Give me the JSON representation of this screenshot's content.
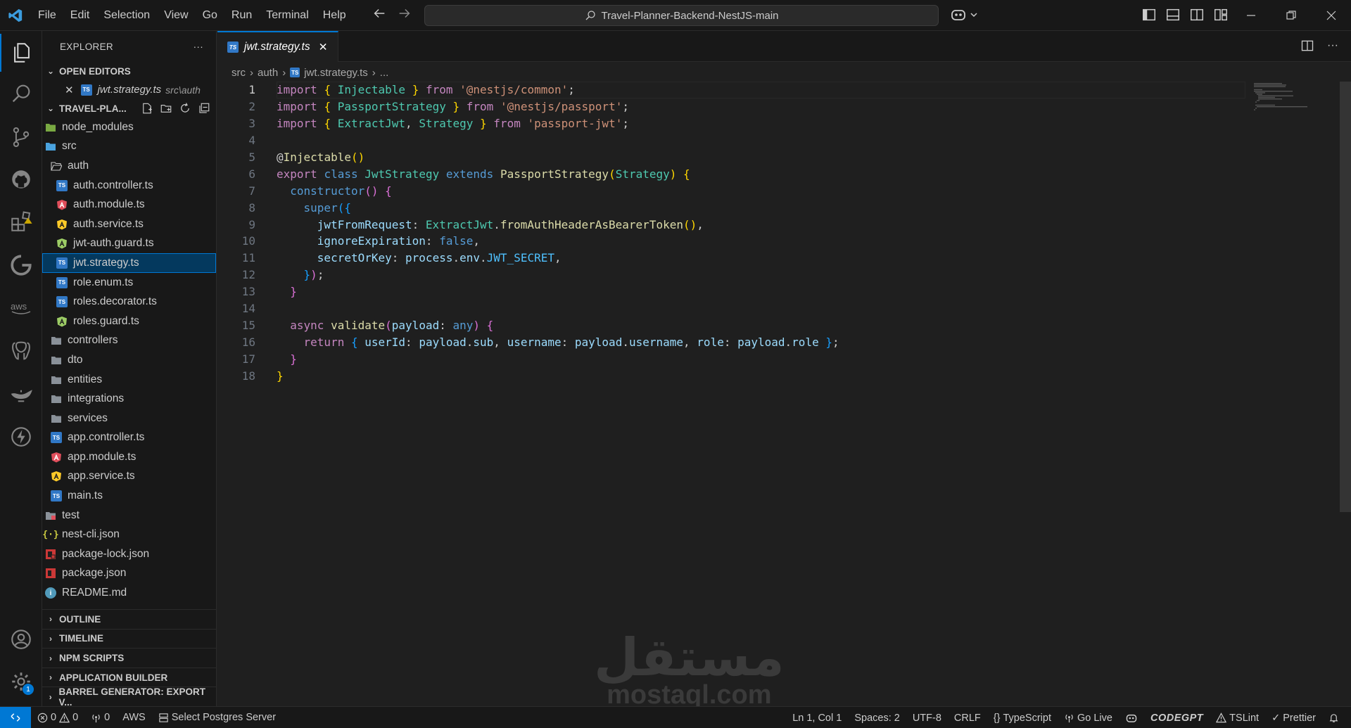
{
  "titlebar": {
    "menu": [
      "File",
      "Edit",
      "Selection",
      "View",
      "Go",
      "Run",
      "Terminal",
      "Help"
    ],
    "search_text": "Travel-Planner-Backend-NestJS-main"
  },
  "explorer": {
    "title": "EXPLORER",
    "open_editors_title": "OPEN EDITORS",
    "open_editor": {
      "name": "jwt.strategy.ts",
      "path": "src\\auth"
    },
    "project_title": "TRAVEL-PLA...",
    "tree": [
      {
        "name": "node_modules",
        "depth": 0,
        "icon": "folder-node-icon"
      },
      {
        "name": "src",
        "depth": 0,
        "icon": "folder-src-icon"
      },
      {
        "name": "auth",
        "depth": 1,
        "icon": "folder-open-icon"
      },
      {
        "name": "auth.controller.ts",
        "depth": 2,
        "icon": "typescript-file-icon"
      },
      {
        "name": "auth.module.ts",
        "depth": 2,
        "icon": "angular-module-icon"
      },
      {
        "name": "auth.service.ts",
        "depth": 2,
        "icon": "angular-service-icon"
      },
      {
        "name": "jwt-auth.guard.ts",
        "depth": 2,
        "icon": "angular-guard-icon"
      },
      {
        "name": "jwt.strategy.ts",
        "depth": 2,
        "icon": "typescript-file-icon",
        "selected": true
      },
      {
        "name": "role.enum.ts",
        "depth": 2,
        "icon": "typescript-file-icon"
      },
      {
        "name": "roles.decorator.ts",
        "depth": 2,
        "icon": "typescript-file-icon"
      },
      {
        "name": "roles.guard.ts",
        "depth": 2,
        "icon": "angular-guard-icon"
      },
      {
        "name": "controllers",
        "depth": 1,
        "icon": "folder-icon"
      },
      {
        "name": "dto",
        "depth": 1,
        "icon": "folder-icon"
      },
      {
        "name": "entities",
        "depth": 1,
        "icon": "folder-icon"
      },
      {
        "name": "integrations",
        "depth": 1,
        "icon": "folder-icon"
      },
      {
        "name": "services",
        "depth": 1,
        "icon": "folder-icon"
      },
      {
        "name": "app.controller.ts",
        "depth": 1,
        "icon": "typescript-file-icon"
      },
      {
        "name": "app.module.ts",
        "depth": 1,
        "icon": "angular-module-icon"
      },
      {
        "name": "app.service.ts",
        "depth": 1,
        "icon": "angular-service-icon"
      },
      {
        "name": "main.ts",
        "depth": 1,
        "icon": "typescript-file-icon"
      },
      {
        "name": "test",
        "depth": 0,
        "icon": "folder-test-icon"
      },
      {
        "name": "nest-cli.json",
        "depth": 0,
        "icon": "json-file-icon"
      },
      {
        "name": "package-lock.json",
        "depth": 0,
        "icon": "npm-lock-icon"
      },
      {
        "name": "package.json",
        "depth": 0,
        "icon": "npm-file-icon"
      },
      {
        "name": "README.md",
        "depth": 0,
        "icon": "info-file-icon"
      }
    ],
    "bottom_sections": [
      "OUTLINE",
      "TIMELINE",
      "NPM SCRIPTS",
      "APPLICATION BUILDER",
      "BARREL GENERATOR: EXPORT V..."
    ]
  },
  "editor": {
    "tab_label": "jwt.strategy.ts",
    "breadcrumb": [
      "src",
      "auth",
      "jwt.strategy.ts",
      "..."
    ],
    "line_numbers": [
      "1",
      "2",
      "3",
      "4",
      "5",
      "6",
      "7",
      "8",
      "9",
      "10",
      "11",
      "12",
      "13",
      "14",
      "15",
      "16",
      "17",
      "18"
    ],
    "code_lines": [
      "import { Injectable } from '@nestjs/common';",
      "import { PassportStrategy } from '@nestjs/passport';",
      "import { ExtractJwt, Strategy } from 'passport-jwt';",
      "",
      "@Injectable()",
      "export class JwtStrategy extends PassportStrategy(Strategy) {",
      "  constructor() {",
      "    super({",
      "      jwtFromRequest: ExtractJwt.fromAuthHeaderAsBearerToken(),",
      "      ignoreExpiration: false,",
      "      secretOrKey: process.env.JWT_SECRET,",
      "    });",
      "  }",
      "",
      "  async validate(payload: any) {",
      "    return { userId: payload.sub, username: payload.username, role: payload.role };",
      "  }",
      "}"
    ]
  },
  "watermark": {
    "arabic": "مستقل",
    "latin": "mostaql.com"
  },
  "statusbar": {
    "errors": "0",
    "warnings": "0",
    "ports": "0",
    "aws": "AWS",
    "postgres": "Select Postgres Server",
    "position": "Ln 1, Col 1",
    "spaces": "Spaces: 2",
    "encoding": "UTF-8",
    "eol": "CRLF",
    "language": "TypeScript",
    "go_live": "Go Live",
    "codegpt": "CODEGPT",
    "tslint": "TSLint",
    "prettier": "Prettier"
  },
  "activity_badge": "1",
  "colors": {
    "accent": "#0078d4",
    "background": "#1f1f1f",
    "sidebar": "#181818",
    "selection": "#04395e",
    "typescript": "#3178c6",
    "angular": "#dd0031"
  }
}
